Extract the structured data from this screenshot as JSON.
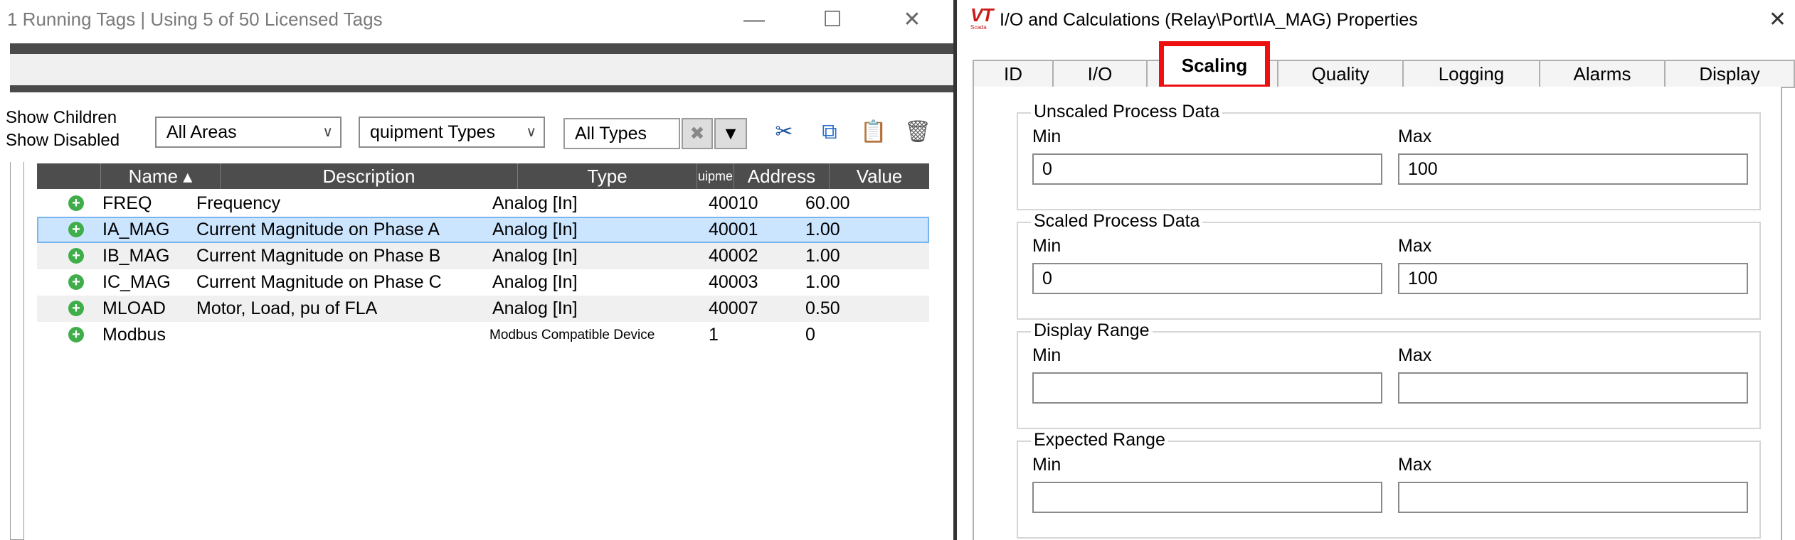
{
  "left_window": {
    "title": "1 Running Tags | Using 5 of 50 Licensed Tags",
    "controls": {
      "minimize": "—",
      "maximize": "☐",
      "close": "✕"
    },
    "show_children_label": "Show Children",
    "show_disabled_label": "Show Disabled",
    "area_filter": {
      "value": "All Areas"
    },
    "equipment_filter": {
      "value": "quipment Types"
    },
    "type_filter": {
      "value": "All Types"
    },
    "clear_filter_glyph": "✖",
    "filter_glyph": "▼",
    "toolbar": {
      "cut_glyph": "✂",
      "copy_glyph": "⧉",
      "paste_glyph": "📋",
      "delete_glyph": "🗑"
    },
    "columns": {
      "name": "Name ▴",
      "description": "Description",
      "type": "Type",
      "equipment": "uipme",
      "address": "Address",
      "value": "Value"
    },
    "rows": [
      {
        "name": "FREQ",
        "description": "Frequency",
        "type": "Analog [In]",
        "address": "40010",
        "value": "60.00"
      },
      {
        "name": "IA_MAG",
        "description": "Current Magnitude on Phase A",
        "type": "Analog [In]",
        "address": "40001",
        "value": "1.00"
      },
      {
        "name": "IB_MAG",
        "description": "Current Magnitude on Phase B",
        "type": "Analog [In]",
        "address": "40002",
        "value": "1.00"
      },
      {
        "name": "IC_MAG",
        "description": "Current Magnitude on Phase C",
        "type": "Analog [In]",
        "address": "40003",
        "value": "1.00"
      },
      {
        "name": "MLOAD",
        "description": "Motor, Load, pu of FLA",
        "type": "Analog [In]",
        "address": "40007",
        "value": "0.50"
      },
      {
        "name": "Modbus",
        "description": "",
        "type": "Modbus Compatible Device",
        "address": "1",
        "value": "0"
      }
    ],
    "selected_row": "IA_MAG"
  },
  "dialog": {
    "logo": "VT",
    "logo_sub": "Scada",
    "title": "I/O and Calculations (Relay\\Port\\IA_MAG) Properties",
    "close_glyph": "✕",
    "tabs": [
      {
        "label": "ID"
      },
      {
        "label": "I/O"
      },
      {
        "label": "Scaling"
      },
      {
        "label": "Quality"
      },
      {
        "label": "Logging"
      },
      {
        "label": "Alarms"
      },
      {
        "label": "Display"
      }
    ],
    "active_tab": "Scaling",
    "groups": {
      "unscaled": {
        "legend": "Unscaled Process Data",
        "min_label": "Min",
        "max_label": "Max",
        "min_value": "0",
        "max_value": "100"
      },
      "scaled": {
        "legend": "Scaled Process Data",
        "min_label": "Min",
        "max_label": "Max",
        "min_value": "0",
        "max_value": "100"
      },
      "display_range": {
        "legend": "Display Range",
        "min_label": "Min",
        "max_label": "Max",
        "min_value": "",
        "max_value": ""
      },
      "expected_range": {
        "legend": "Expected Range",
        "min_label": "Min",
        "max_label": "Max",
        "min_value": "",
        "max_value": ""
      }
    }
  },
  "colors": {
    "highlight_box": "#ee1010",
    "selected_row": "#cce5ff",
    "header_bg": "#4d4d4d",
    "add_icon": "#3fae4a",
    "logo": "#cc1a1a"
  }
}
